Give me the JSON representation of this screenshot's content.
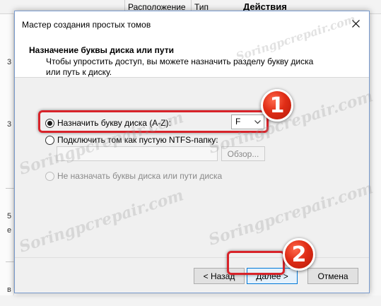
{
  "background": {
    "columns": [
      "Расположение",
      "Тип",
      "Действия"
    ],
    "left_marks": [
      "3",
      "3",
      "5",
      "е",
      "в"
    ]
  },
  "dialog": {
    "title": "Мастер создания простых томов",
    "header": {
      "title": "Назначение буквы диска или пути",
      "description": "Чтобы упростить доступ, вы можете назначить разделу букву диска или путь к диску."
    },
    "options": {
      "assign_letter": "Назначить букву диска (A-Z):",
      "mount_folder": "Подключить том как пустую NTFS-папку:",
      "no_letter": "Не назначать буквы диска или пути диска"
    },
    "drive_letter": "F",
    "browse_label": "Обзор...",
    "buttons": {
      "back": "< Назад",
      "next": "Далее >",
      "cancel": "Отмена"
    }
  },
  "annotations": {
    "badge1": "1",
    "badge2": "2"
  },
  "watermark": "Soringpcrepair.com",
  "colors": {
    "highlight": "#d8232a",
    "badge": "#e02d16",
    "accent": "#0078d7"
  }
}
